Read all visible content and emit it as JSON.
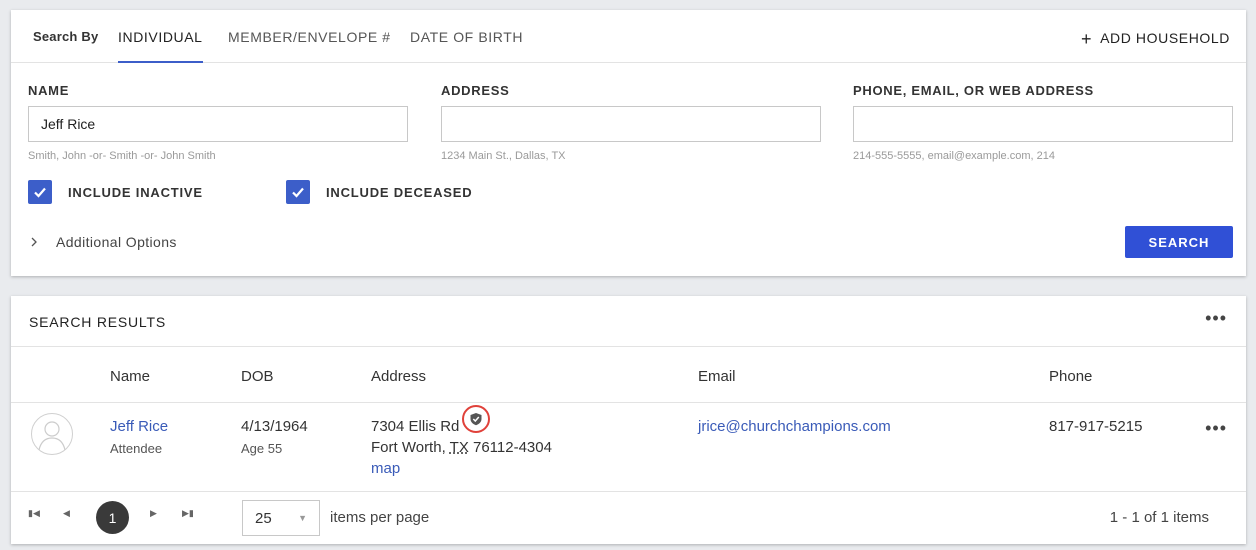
{
  "search": {
    "search_by_label": "Search By",
    "tabs": [
      "INDIVIDUAL",
      "MEMBER/ENVELOPE #",
      "DATE OF BIRTH"
    ],
    "active_tab": "INDIVIDUAL",
    "add_household": "ADD HOUSEHOLD",
    "fields": {
      "name": {
        "label": "NAME",
        "value": "Jeff Rice",
        "hint": "Smith, John -or- Smith -or- John Smith"
      },
      "address": {
        "label": "ADDRESS",
        "value": "",
        "hint": "1234 Main St., Dallas, TX"
      },
      "contact": {
        "label": "PHONE, EMAIL, OR WEB ADDRESS",
        "value": "",
        "hint": "214-555-5555, email@example.com, 214"
      }
    },
    "include_inactive": {
      "label": "INCLUDE INACTIVE",
      "checked": true
    },
    "include_deceased": {
      "label": "INCLUDE DECEASED",
      "checked": true
    },
    "additional_options": "Additional Options",
    "search_button": "SEARCH"
  },
  "results": {
    "title": "SEARCH RESULTS",
    "columns": {
      "name": "Name",
      "dob": "DOB",
      "address": "Address",
      "email": "Email",
      "phone": "Phone"
    },
    "rows": [
      {
        "name": "Jeff Rice",
        "role": "Attendee",
        "dob": "4/13/1964",
        "age": "Age 55",
        "address_line1": "7304 Ellis Rd",
        "city": "Fort Worth,",
        "state": "TX",
        "zip": "76112-4304",
        "map": "map",
        "email": "jrice@churchchampions.com",
        "phone": "817-917-5215"
      }
    ],
    "pager": {
      "current_page": "1",
      "per_page": "25",
      "per_page_label": "items per page",
      "count": "1 - 1 of 1 items"
    }
  },
  "icons": {
    "checkbox_color": "#3c5ec9",
    "button_color": "#3050d6",
    "link_color": "#3a5bb8",
    "highlight_ring": "#e0413a",
    "verified": "shield-check-icon"
  },
  "kebab": "•••"
}
